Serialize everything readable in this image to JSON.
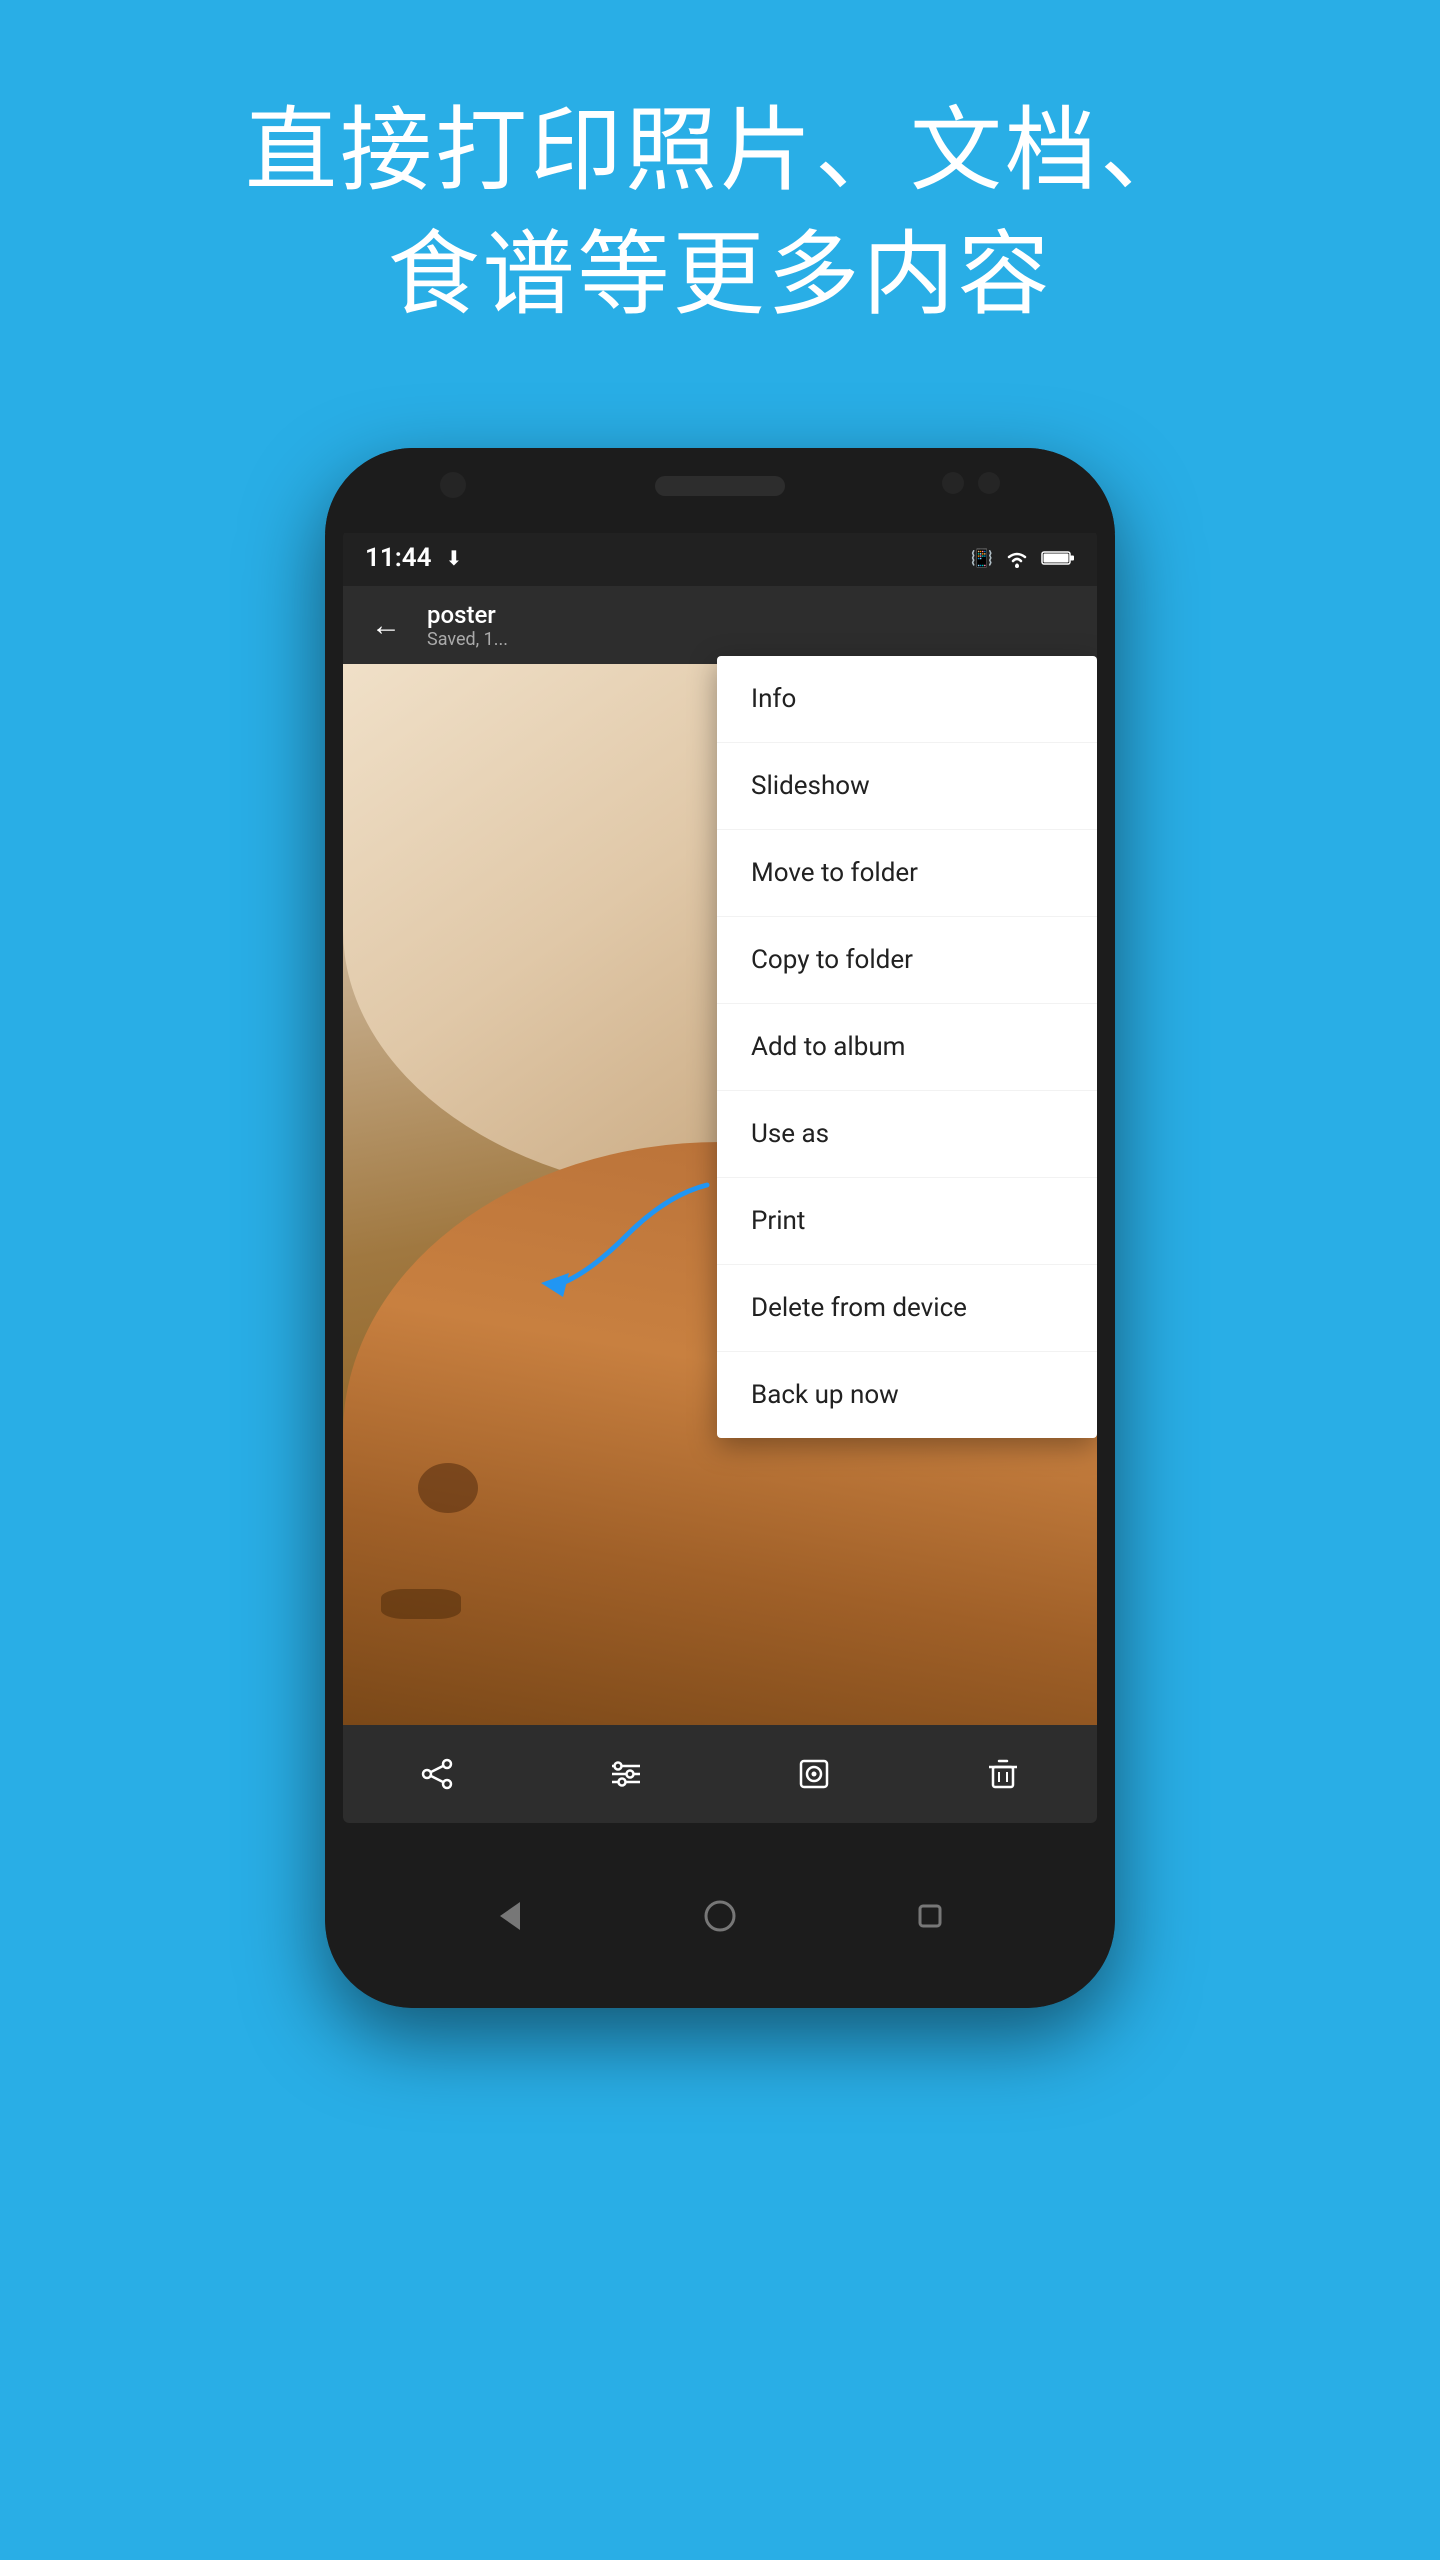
{
  "page": {
    "background_color": "#29aee6",
    "header": {
      "line1": "直接打印照片、文档、",
      "line2": "食谱等更多内容"
    }
  },
  "phone": {
    "status_bar": {
      "time": "11:44",
      "icons": [
        "download",
        "vibrate",
        "wifi",
        "battery"
      ]
    },
    "toolbar": {
      "back_label": "←",
      "title": "poster",
      "subtitle": "Saved, 1..."
    },
    "context_menu": {
      "items": [
        {
          "id": "info",
          "label": "Info"
        },
        {
          "id": "slideshow",
          "label": "Slideshow"
        },
        {
          "id": "move-to-folder",
          "label": "Move to folder"
        },
        {
          "id": "copy-to-folder",
          "label": "Copy to folder"
        },
        {
          "id": "add-to-album",
          "label": "Add to album"
        },
        {
          "id": "use-as",
          "label": "Use as"
        },
        {
          "id": "print",
          "label": "Print"
        },
        {
          "id": "delete-from-device",
          "label": "Delete from device"
        },
        {
          "id": "back-up-now",
          "label": "Back up now"
        }
      ]
    },
    "bottom_toolbar": {
      "icons": [
        "share",
        "adjust",
        "copy",
        "delete"
      ]
    },
    "nav_bar": {
      "icons": [
        "back",
        "home",
        "recents"
      ]
    }
  },
  "annotation": {
    "arrow_color": "#2196f3"
  }
}
